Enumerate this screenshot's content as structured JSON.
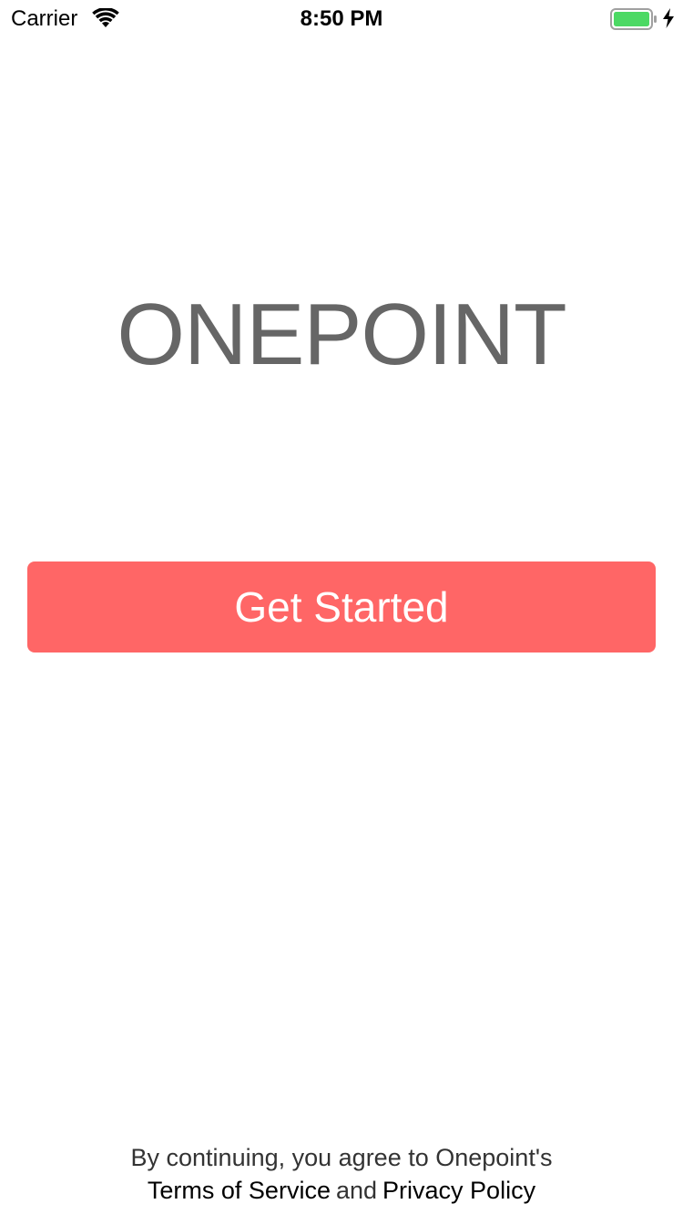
{
  "status_bar": {
    "carrier": "Carrier",
    "time": "8:50 PM",
    "battery_level": 1.0,
    "charging": true,
    "battery_color": "#4cd964"
  },
  "logo": {
    "text": "ONEPOINT",
    "color": "#666666"
  },
  "get_started": {
    "label": "Get Started",
    "background": "#ff6666"
  },
  "legal": {
    "intro": "By continuing, you agree to Onepoint's",
    "terms_label": "Terms of Service",
    "and": "and",
    "privacy_label": "Privacy Policy"
  }
}
